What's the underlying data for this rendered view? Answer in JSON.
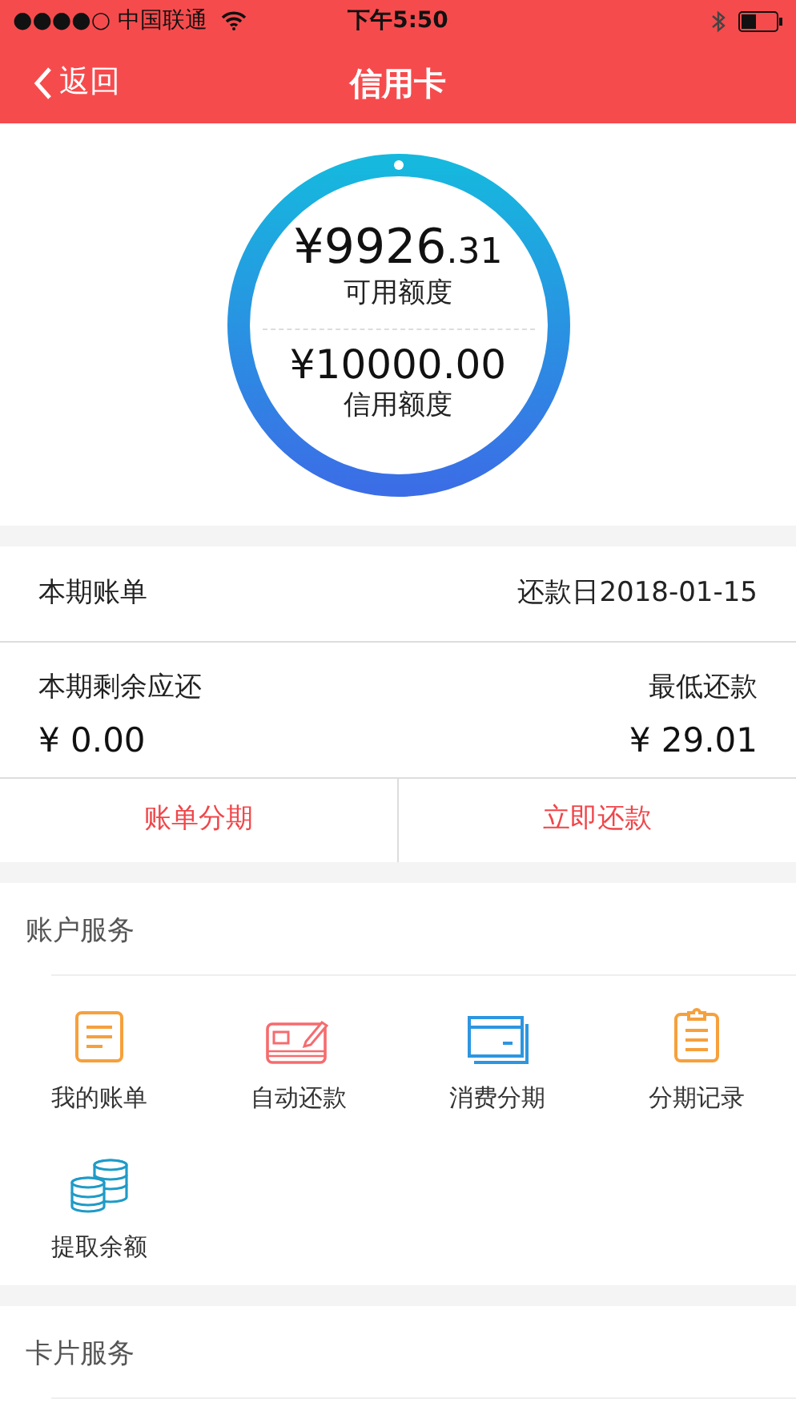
{
  "status_bar": {
    "carrier": "●●●●○ 中国联通",
    "time": "下午5:50"
  },
  "nav": {
    "back": "返回",
    "title": "信用卡"
  },
  "credit": {
    "available_main": "¥9926",
    "available_decimal": ".31",
    "available_label": "可用额度",
    "limit": "¥10000.00",
    "limit_label": "信用额度"
  },
  "bill": {
    "title": "本期账单",
    "due": "还款日2018-01-15",
    "remaining_label": "本期剩余应还",
    "remaining": "¥ 0.00",
    "minimum_label": "最低还款",
    "minimum": "¥ 29.01"
  },
  "actions": [
    "账单分期",
    "立即还款"
  ],
  "account_services": {
    "title": "账户服务",
    "items": [
      {
        "label": "我的账单"
      },
      {
        "label": "自动还款"
      },
      {
        "label": "消费分期"
      },
      {
        "label": "分期记录"
      },
      {
        "label": "提取余额"
      }
    ]
  },
  "card_services": {
    "title": "卡片服务"
  }
}
